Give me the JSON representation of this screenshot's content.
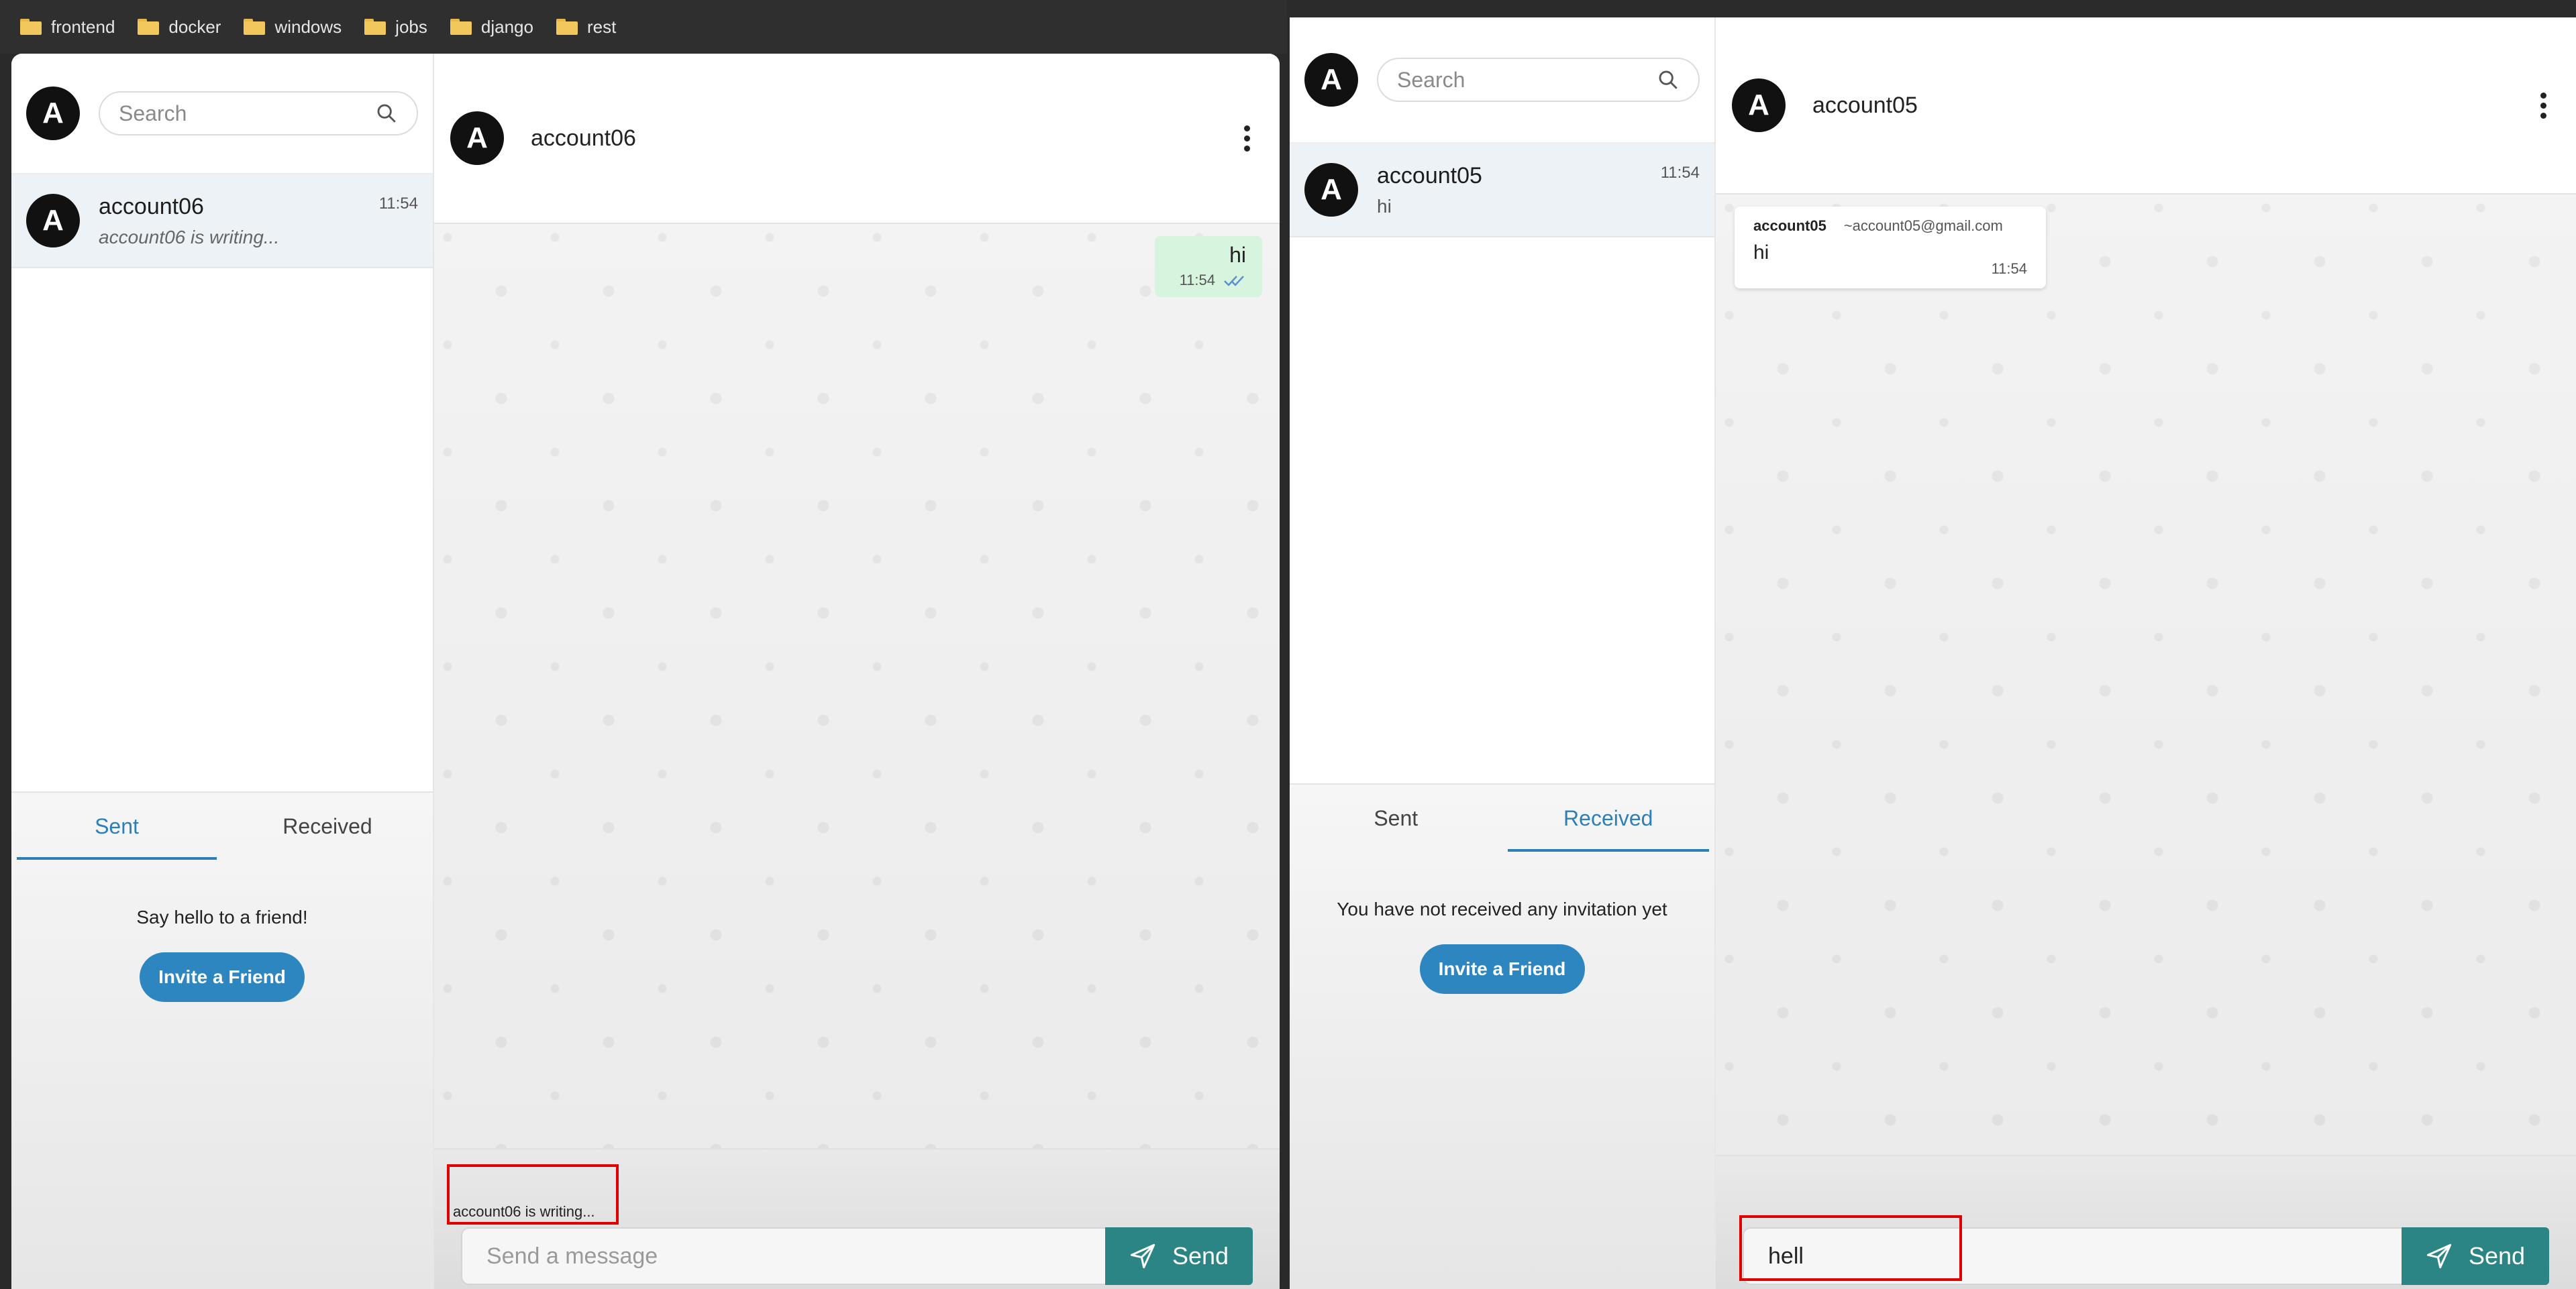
{
  "bookmarks": [
    "frontend",
    "docker",
    "windows",
    "jobs",
    "django",
    "rest"
  ],
  "left_window": {
    "sidebar": {
      "avatar_letter": "A",
      "search_placeholder": "Search",
      "conversation": {
        "name": "account06",
        "status": "account06 is writing...",
        "time": "11:54"
      },
      "tabs": {
        "sent": "Sent",
        "received": "Received",
        "active": "Sent"
      },
      "tab_message": "Say hello to a friend!",
      "invite_label": "Invite a Friend"
    },
    "chat": {
      "header_avatar_letter": "A",
      "header_name": "account06",
      "messages": [
        {
          "direction": "sent",
          "text": "hi",
          "time": "11:54",
          "read": true
        }
      ],
      "typing_indicator": "account06 is writing...",
      "input_placeholder": "Send a message",
      "input_value": "",
      "send_label": "Send"
    }
  },
  "right_window": {
    "sidebar": {
      "avatar_letter": "A",
      "search_placeholder": "Search",
      "conversation": {
        "name": "account05",
        "last_message": "hi",
        "time": "11:54"
      },
      "tabs": {
        "sent": "Sent",
        "received": "Received",
        "active": "Received"
      },
      "tab_message": "You have not received any invitation yet",
      "invite_label": "Invite a Friend"
    },
    "chat": {
      "header_avatar_letter": "A",
      "header_name": "account05",
      "messages": [
        {
          "direction": "received",
          "sender": "account05",
          "email": "~account05@gmail.com",
          "text": "hi",
          "time": "11:54"
        }
      ],
      "input_value": "hell",
      "send_label": "Send"
    }
  },
  "colors": {
    "accent_blue": "#2e86c1",
    "send_teal": "#2b8585",
    "sent_bubble": "#d6f4de",
    "highlight_red": "#e00000"
  }
}
